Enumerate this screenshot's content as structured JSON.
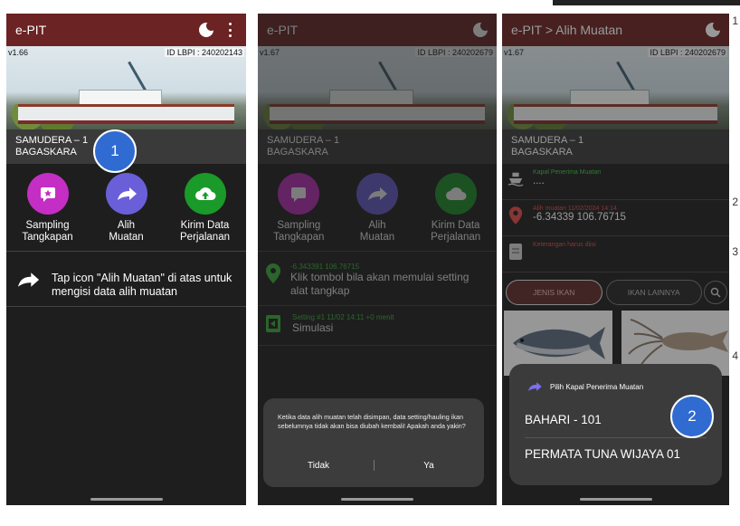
{
  "app_title": "e-PIT",
  "phone1": {
    "version": "v1.66",
    "id_lbpi": "ID LBPI : 240202143",
    "vessel_line1": "SAMUDERA – 1",
    "vessel_line2": "BAGASKARA",
    "actions": [
      {
        "line1": "Sampling",
        "line2": "Tangkapan"
      },
      {
        "line1": "Alih",
        "line2": "Muatan"
      },
      {
        "line1": "Kirim Data",
        "line2": "Perjalanan"
      }
    ],
    "hint": "Tap icon \"Alih Muatan\" di atas untuk mengisi data alih muatan",
    "step_number": "1"
  },
  "phone2": {
    "version": "v1.67",
    "id_lbpi": "ID LBPI : 240202679",
    "vessel_line1": "SAMUDERA – 1",
    "vessel_line2": "BAGASKARA",
    "actions": [
      {
        "line1": "Sampling",
        "line2": "Tangkapan"
      },
      {
        "line1": "Alih",
        "line2": "Muatan"
      },
      {
        "line1": "Kirim Data",
        "line2": "Perjalanan"
      }
    ],
    "location_coords": "-6.343391 106.76715",
    "location_text": "Klik tombol bila akan memulai setting alat tangkap",
    "setting_meta": "Setting #1 11/02 14:11 +0 menit",
    "setting_text": "Simulasi",
    "dialog_message": "Ketika data alih muatan telah disimpan, data setting/hauling ikan sebelumnya tidak akan bisa diubah kembali! Apakah anda yakin?",
    "dialog_no": "Tidak",
    "dialog_yes": "Ya"
  },
  "phone3": {
    "title": "e-PIT > Alih Muatan",
    "version": "v1.67",
    "id_lbpi": "ID LBPI : 240202679",
    "vessel_line1": "SAMUDERA – 1",
    "vessel_line2": "BAGASKARA",
    "receiver_label": "Kapal Penerima Muatan",
    "receiver_value": "....",
    "loc_label": "Alih muatan 11/02/2024 14:14",
    "loc_value": "-6.34339 106.76715",
    "note_label": "Keterangan harus diisi",
    "tab_jenis": "JENIS IKAN",
    "tab_lainnya": "IKAN LAINNYA",
    "sheet_title": "Pilih Kapal Penerima Muatan",
    "sheet_options": [
      "BAHARI - 101",
      "PERMATA TUNA WIJAYA 01"
    ],
    "step_number": "2"
  },
  "side_numbers": [
    "1",
    "2",
    "3",
    "4"
  ]
}
